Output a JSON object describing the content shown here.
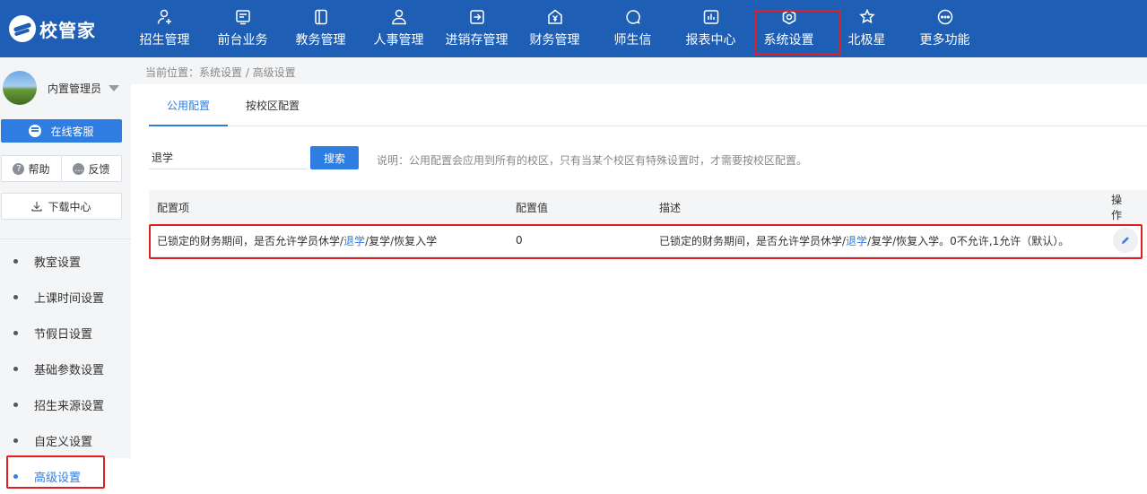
{
  "brand": {
    "name": "校管家"
  },
  "nav": {
    "items": [
      {
        "label": "招生管理",
        "icon": "user-plus-icon"
      },
      {
        "label": "前台业务",
        "icon": "monitor-icon"
      },
      {
        "label": "教务管理",
        "icon": "book-icon"
      },
      {
        "label": "人事管理",
        "icon": "person-icon"
      },
      {
        "label": "进销存管理",
        "icon": "box-arrow-icon"
      },
      {
        "label": "财务管理",
        "icon": "yen-icon"
      },
      {
        "label": "师生信",
        "icon": "chat-bubble-icon"
      },
      {
        "label": "报表中心",
        "icon": "bar-chart-icon"
      },
      {
        "label": "系统设置",
        "icon": "gear-icon",
        "active": true
      },
      {
        "label": "北极星",
        "icon": "star-icon"
      },
      {
        "label": "更多功能",
        "icon": "more-icon"
      }
    ]
  },
  "sidebar": {
    "user_name": "内置管理员",
    "service_label": "在线客服",
    "help_label": "帮助",
    "feedback_label": "反馈",
    "download_label": "下载中心",
    "menu": [
      {
        "label": "教室设置"
      },
      {
        "label": "上课时间设置"
      },
      {
        "label": "节假日设置"
      },
      {
        "label": "基础参数设置"
      },
      {
        "label": "招生来源设置"
      },
      {
        "label": "自定义设置"
      },
      {
        "label": "高级设置",
        "active": true
      }
    ]
  },
  "breadcrumb": "当前位置：系统设置 / 高级设置",
  "tabs": [
    {
      "label": "公用配置",
      "active": true
    },
    {
      "label": "按校区配置"
    }
  ],
  "search": {
    "value": "退学",
    "button_label": "搜索"
  },
  "note": "说明：公用配置会应用到所有的校区，只有当某个校区有特殊设置时，才需要按校区配置。",
  "table": {
    "headers": {
      "item": "配置项",
      "value": "配置值",
      "desc": "描述",
      "action": "操作"
    },
    "rows": [
      {
        "item_pre": "已锁定的财务期间，是否允许学员休学/",
        "item_kw": "退学",
        "item_post": "/复学/恢复入学",
        "value": "0",
        "desc_pre": "已锁定的财务期间，是否允许学员休学/",
        "desc_kw": "退学",
        "desc_post": "/复学/恢复入学。0不允许,1允许（默认）。"
      }
    ]
  },
  "colors": {
    "primary": "#1e5eb5",
    "accent": "#2f7de1",
    "highlight": "#e02020"
  }
}
